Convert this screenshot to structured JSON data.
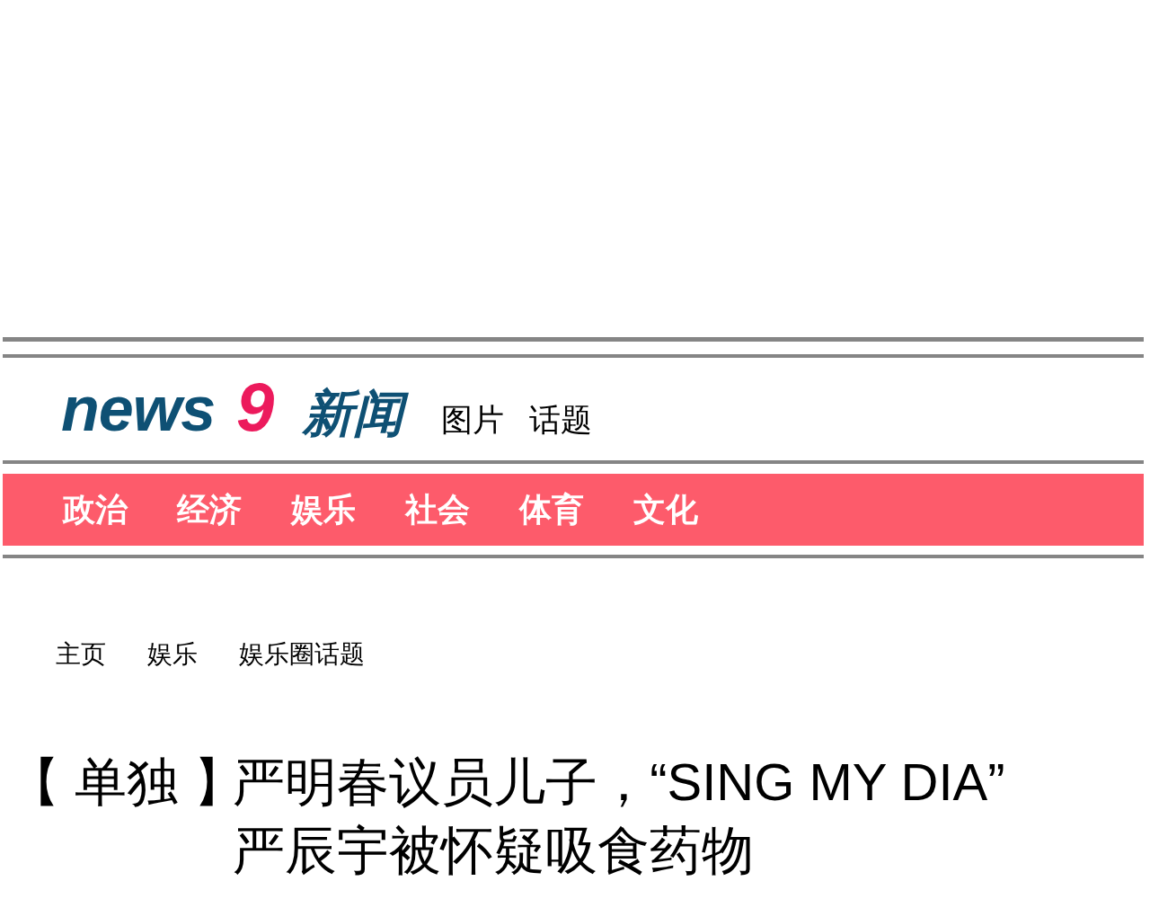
{
  "header": {
    "logo": {
      "name": "news",
      "number": "9",
      "suffix": "新闻"
    },
    "links": [
      "图片",
      "话题"
    ]
  },
  "categories": [
    "政治",
    "经济",
    "娱乐",
    "社会",
    "体育",
    "文化"
  ],
  "breadcrumb": [
    "主页",
    "娱乐",
    "娱乐圈话题"
  ],
  "headline": {
    "tag": "【 单独 】",
    "lines": [
      "严明春议员儿子，“SING MY DIA”",
      "严辰宇被怀疑吸食药物"
    ]
  }
}
